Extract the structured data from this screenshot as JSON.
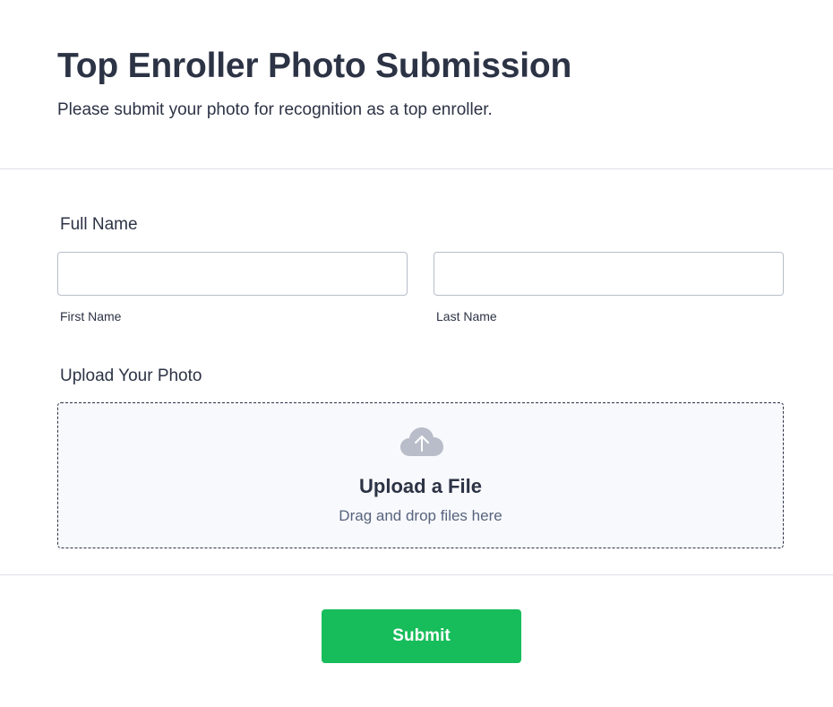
{
  "header": {
    "title": "Top Enroller Photo Submission",
    "subtitle": "Please submit your photo for recognition as a top enroller."
  },
  "full_name": {
    "label": "Full Name",
    "first": {
      "value": "",
      "placeholder": "",
      "sublabel": "First Name"
    },
    "last": {
      "value": "",
      "placeholder": "",
      "sublabel": "Last Name"
    }
  },
  "upload": {
    "label": "Upload Your Photo",
    "title": "Upload a File",
    "hint": "Drag and drop files here",
    "icon": "cloud-upload-icon"
  },
  "submit": {
    "label": "Submit"
  },
  "colors": {
    "accent": "#18bd5b",
    "text": "#2c3345",
    "muted": "#57647e",
    "dropzone_bg": "#f8f9fc",
    "icon": "#b8bdc9"
  }
}
